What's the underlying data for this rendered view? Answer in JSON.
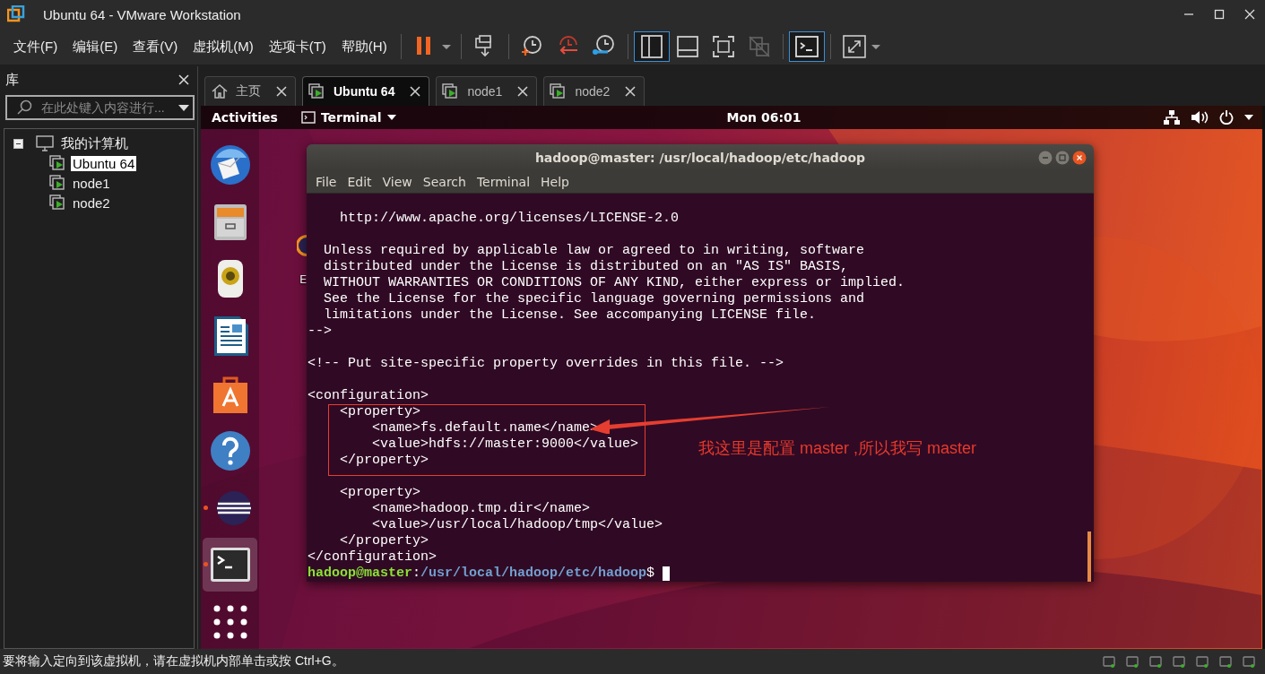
{
  "window": {
    "title": "Ubuntu 64 - VMware Workstation"
  },
  "menu": [
    "文件(F)",
    "编辑(E)",
    "查看(V)",
    "虚拟机(M)",
    "选项卡(T)",
    "帮助(H)"
  ],
  "toolbar": [
    {
      "kind": "pause",
      "selected": false,
      "disabled": false
    },
    {
      "kind": "send-keys",
      "selected": false,
      "disabled": false
    },
    {
      "kind": "snapshot",
      "selected": false,
      "disabled": false
    },
    {
      "kind": "revert",
      "selected": false,
      "disabled": false
    },
    {
      "kind": "manage-snapshots",
      "selected": false,
      "disabled": false
    },
    {
      "kind": "library-view",
      "selected": true,
      "disabled": false
    },
    {
      "kind": "thumbnail-view",
      "selected": false,
      "disabled": false
    },
    {
      "kind": "full-screen",
      "selected": false,
      "disabled": false
    },
    {
      "kind": "unity",
      "selected": false,
      "disabled": true
    },
    {
      "kind": "console",
      "selected": true,
      "disabled": false
    },
    {
      "kind": "stretch",
      "selected": false,
      "disabled": false
    }
  ],
  "library": {
    "title": "库",
    "search": {
      "placeholder": "在此处键入内容进行..."
    },
    "tree": [
      {
        "label": "我的计算机",
        "expanded": true,
        "children": [
          {
            "label": "Ubuntu 64",
            "selected": true
          },
          {
            "label": "node1",
            "selected": false
          },
          {
            "label": "node2",
            "selected": false
          }
        ]
      }
    ]
  },
  "tabs": [
    {
      "label": "主页",
      "kind": "home",
      "selected": false
    },
    {
      "label": "Ubuntu 64",
      "kind": "vm",
      "selected": true
    },
    {
      "label": "node1",
      "kind": "vm",
      "selected": false
    },
    {
      "label": "node2",
      "kind": "vm",
      "selected": false
    }
  ],
  "guest": {
    "activities": "Activities",
    "app_menu": "Terminal",
    "clock": "Mon 06:01",
    "dock": [
      {
        "kind": "mail",
        "running": false,
        "selected": false
      },
      {
        "kind": "files",
        "running": false,
        "selected": false
      },
      {
        "kind": "music",
        "running": false,
        "selected": false
      },
      {
        "kind": "writer",
        "running": false,
        "selected": false
      },
      {
        "kind": "store",
        "running": false,
        "selected": false
      },
      {
        "kind": "help",
        "running": false,
        "selected": false
      },
      {
        "kind": "eclipse",
        "running": true,
        "selected": false
      },
      {
        "kind": "terminal",
        "running": true,
        "selected": true
      },
      {
        "kind": "apps",
        "running": false,
        "selected": false
      }
    ],
    "desktop_icon_label": "E",
    "terminal": {
      "title": "hadoop@master: /usr/local/hadoop/etc/hadoop",
      "menu": [
        "File",
        "Edit",
        "View",
        "Search",
        "Terminal",
        "Help"
      ],
      "blocks": [
        [
          "    http://www.apache.org/licenses/LICENSE-2.0"
        ],
        [
          "  Unless required by applicable law or agreed to in writing, software",
          "  distributed under the License is distributed on an \"AS IS\" BASIS,",
          "  WITHOUT WARRANTIES OR CONDITIONS OF ANY KIND, either express or implied.",
          "  See the License for the specific language governing permissions and",
          "  limitations under the License. See accompanying LICENSE file.",
          "-->"
        ],
        [
          "<!-- Put site-specific property overrides in this file. -->"
        ],
        [
          "<configuration>",
          "    <property>",
          "        <name>fs.default.name</name>",
          "        <value>hdfs://master:9000</value>",
          "    </property>"
        ],
        [
          "    <property>",
          "        <name>hadoop.tmp.dir</name>",
          "        <value>/usr/local/hadoop/tmp</value>",
          "    </property>",
          "</configuration>"
        ]
      ],
      "prompt": {
        "user_host": "hadoop@master",
        "separator": ":",
        "path": "/usr/local/hadoop/etc/hadoop",
        "symbol": "$"
      }
    },
    "annotation": {
      "text": "我这里是配置 master ,所以我写 master"
    }
  },
  "status_bar": {
    "text": "要将输入定向到该虚拟机，请在虚拟机内部单击或按 Ctrl+G。"
  }
}
